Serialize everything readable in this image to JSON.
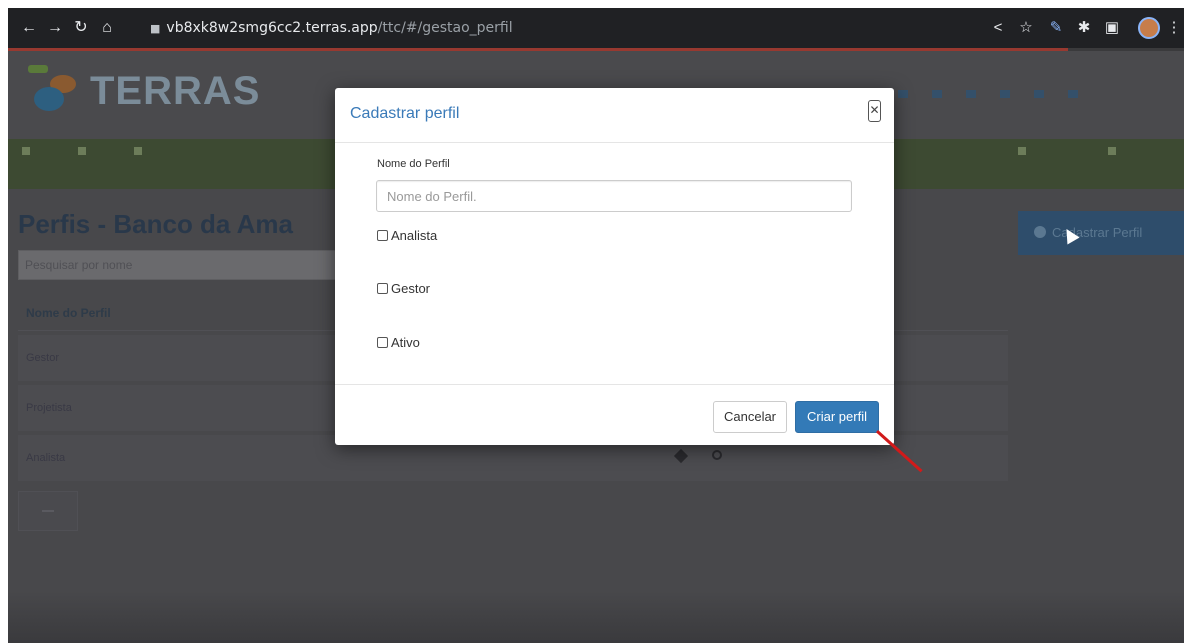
{
  "browser": {
    "url_host": "vb8xk8w2smg6cc2.terras.app",
    "url_path": "/ttc/#/gestao_perfil"
  },
  "app": {
    "logo_text": "TERRAS"
  },
  "page": {
    "title": "Perfis - Banco da Ama",
    "search_placeholder": "Pesquisar por nome",
    "action_button": "Cadastrar Perfil",
    "table": {
      "header": "Nome do Perfil",
      "rows": [
        "Gestor",
        "Projetista",
        "Analista"
      ]
    }
  },
  "modal": {
    "title": "Cadastrar perfil",
    "field_label": "Nome do Perfil",
    "field_placeholder": "Nome do Perfil.",
    "checkboxes": [
      "Analista",
      "Gestor",
      "Ativo"
    ],
    "cancel_label": "Cancelar",
    "create_label": "Criar perfil"
  },
  "colors": {
    "modal_title": "#3a7ab8",
    "primary_button": "#337ab7",
    "annotation_arrow": "#d11a1a"
  }
}
